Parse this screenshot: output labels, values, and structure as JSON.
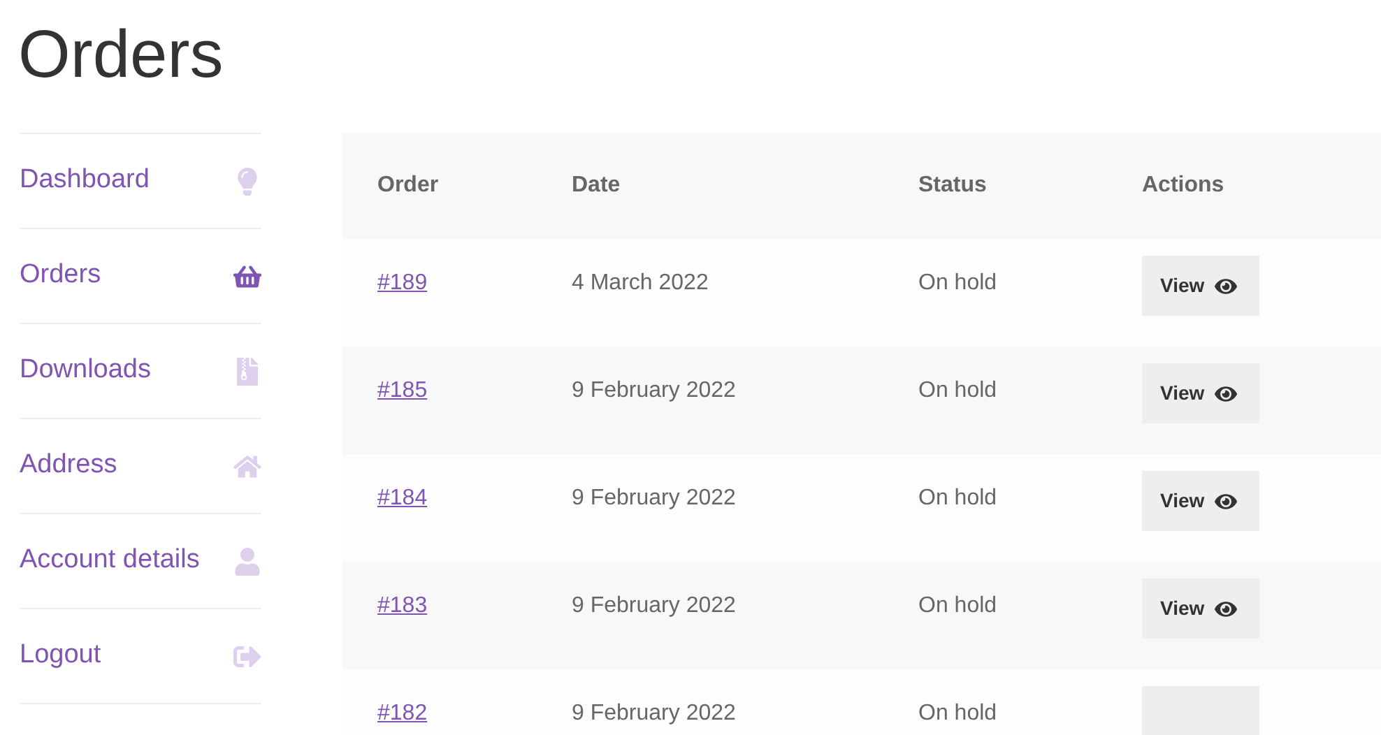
{
  "page_title": "Orders",
  "nav": [
    {
      "label": "Dashboard",
      "kind": "dashboard",
      "selected": false
    },
    {
      "label": "Orders",
      "kind": "orders",
      "selected": true
    },
    {
      "label": "Downloads",
      "kind": "downloads",
      "selected": false
    },
    {
      "label": "Address",
      "kind": "address",
      "selected": false
    },
    {
      "label": "Account details",
      "kind": "account",
      "selected": false
    },
    {
      "label": "Logout",
      "kind": "logout",
      "selected": false
    }
  ],
  "table": {
    "columns": [
      "Order",
      "Date",
      "Status",
      "Actions"
    ],
    "rows": [
      {
        "order": "#189",
        "date": "4 March 2022",
        "status": "On hold",
        "action": "View"
      },
      {
        "order": "#185",
        "date": "9 February 2022",
        "status": "On hold",
        "action": "View"
      },
      {
        "order": "#184",
        "date": "9 February 2022",
        "status": "On hold",
        "action": "View"
      },
      {
        "order": "#183",
        "date": "9 February 2022",
        "status": "On hold",
        "action": "View"
      },
      {
        "order": "#182",
        "date": "9 February 2022",
        "status": "On hold"
      }
    ]
  }
}
